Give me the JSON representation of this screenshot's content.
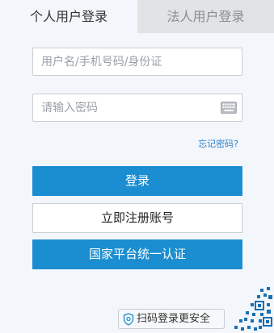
{
  "tabs": {
    "personal": "个人用户登录",
    "corporate": "法人用户登录"
  },
  "form": {
    "username_placeholder": "用户名/手机号码/身份证",
    "password_placeholder": "请输入密码",
    "forgot_password": "忘记密码?"
  },
  "buttons": {
    "login": "登录",
    "register": "立即注册账号",
    "national_auth": "国家平台统一认证"
  },
  "scan": {
    "label": "扫码登录更安全"
  },
  "colors": {
    "primary": "#1a8ed0",
    "link": "#2a7fc9",
    "background": "#f3f6fb",
    "inactive_tab": "#e2e3e5"
  },
  "icons": {
    "keyboard": "keyboard-icon",
    "shield": "shield-icon",
    "qr": "qr-code-icon"
  }
}
